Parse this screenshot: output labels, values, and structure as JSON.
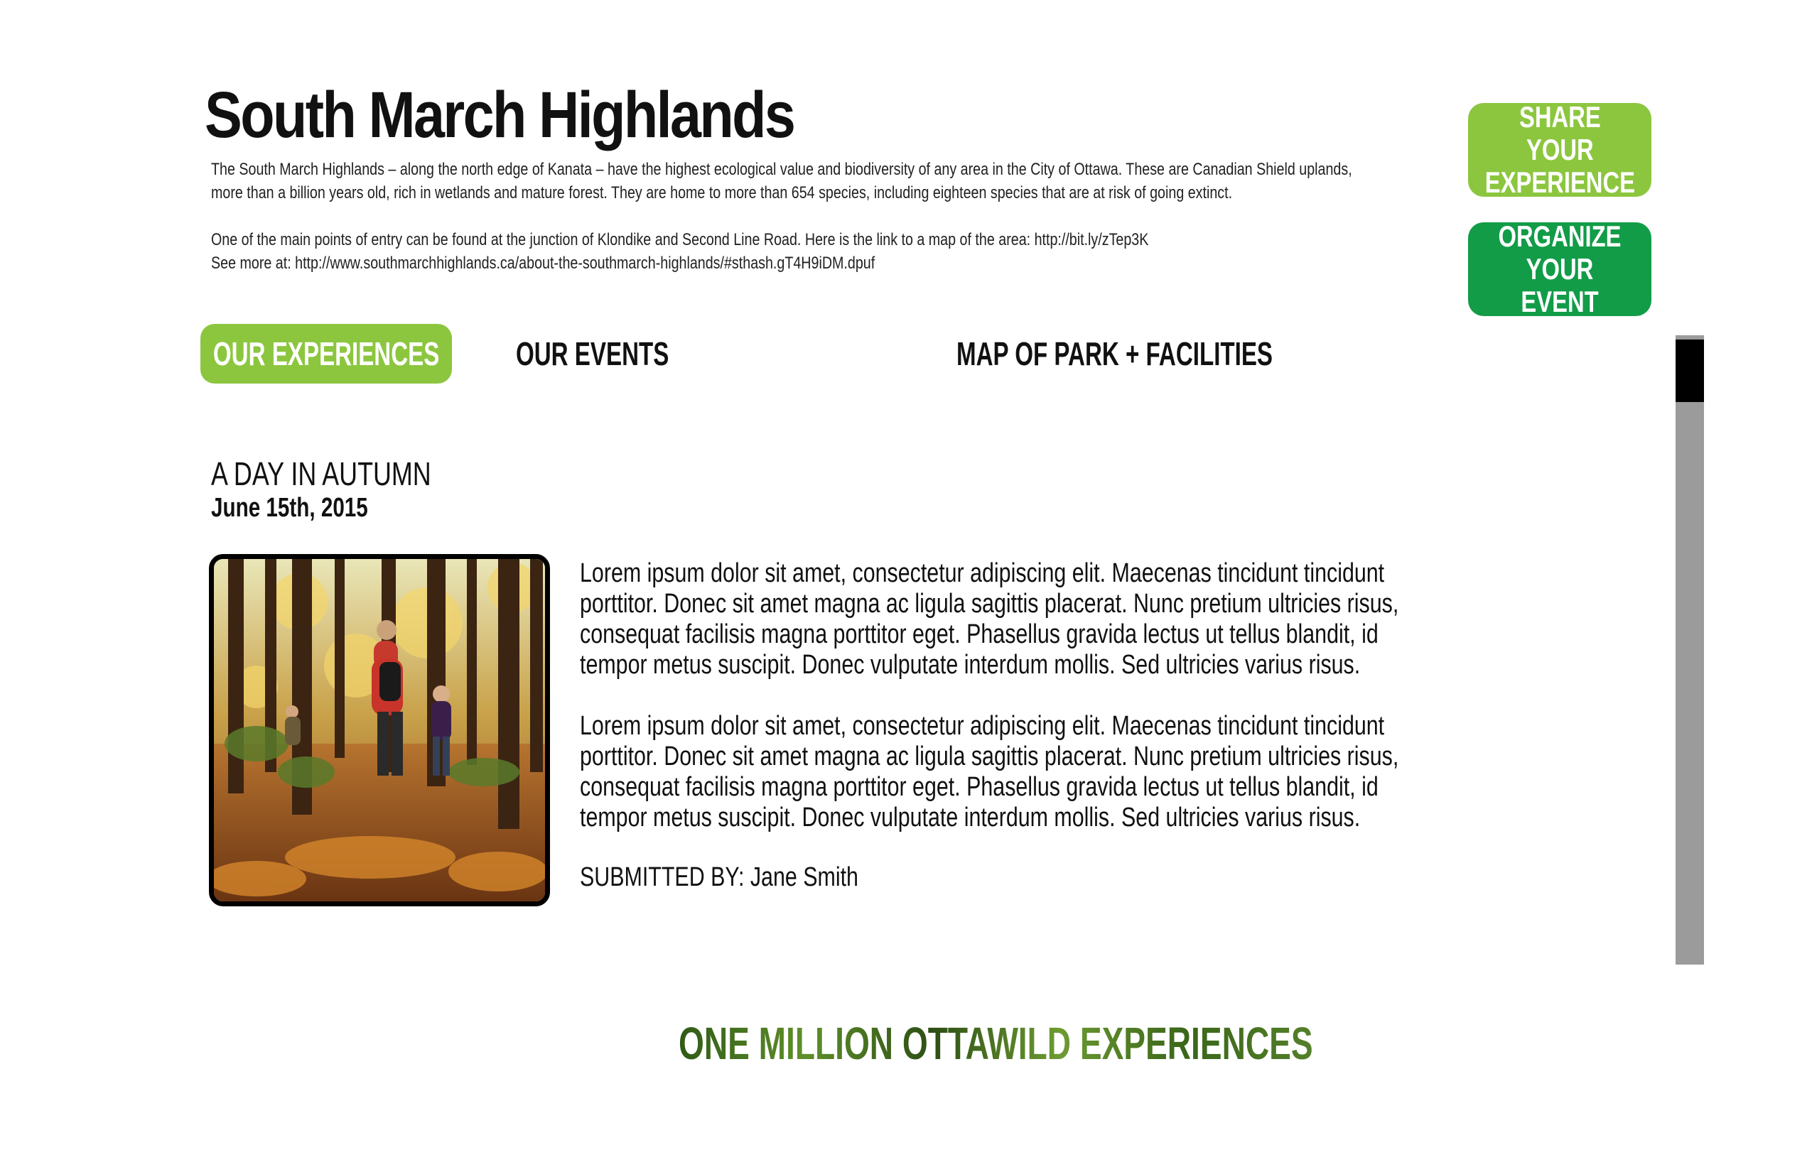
{
  "header": {
    "title": "South March Highlands",
    "intro_line1": "The South March Highlands – along the north edge of Kanata – have the highest ecological value and biodiversity of any area in the City of Ottawa. These are Canadian Shield uplands,",
    "intro_line2": "more than a billion years old, rich in wetlands and mature forest. They are home to more than 654 species, including eighteen species that are at risk of going extinct.",
    "intro_line3": "One of the main points of entry can be found at the junction of Klondike and Second Line Road. Here is the link to a map of the area: http://bit.ly/zTep3K",
    "intro_line4": "See more at: http://www.southmarchhighlands.ca/about-the-southmarch-highlands/#sthash.gT4H9iDM.dpuf"
  },
  "sidebar": {
    "share_label": "SHARE YOUR EXPERIENCE",
    "organize_label": "ORGANIZE YOUR EVENT"
  },
  "tabs": [
    {
      "label": "OUR EXPERIENCES",
      "active": true
    },
    {
      "label": "OUR EVENTS",
      "active": false
    },
    {
      "label": "MAP OF PARK + FACILITIES",
      "active": false
    }
  ],
  "experience": {
    "title": "A DAY IN AUTUMN",
    "date": "June 15th, 2015",
    "paragraph1": "Lorem ipsum dolor sit amet, consectetur adipiscing elit. Maecenas tincidunt tincidunt porttitor. Donec sit amet magna ac ligula sagittis placerat. Nunc pretium ultricies risus, consequat facilisis magna porttitor eget. Phasellus gravida lectus ut tellus blandit, id tempor metus suscipit. Donec vulputate interdum mollis. Sed ultricies varius risus.",
    "paragraph2": "Lorem ipsum dolor sit amet, consectetur adipiscing elit. Maecenas tincidunt tincidunt porttitor. Donec sit amet magna ac ligula sagittis placerat. Nunc pretium ultricies risus, consequat facilisis magna porttitor eget. Phasellus gravida lectus ut tellus blandit, id tempor metus suscipit. Donec vulputate interdum mollis. Sed ultricies varius risus.",
    "submitted_by": "SUBMITTED BY: Jane Smith"
  },
  "footer": {
    "tagline": "ONE MILLION OTTAWILD EXPERIENCES"
  },
  "colors": {
    "light_green": "#8cc63f",
    "dark_green": "#129c48",
    "scrollbar_track": "#9b9b9b",
    "scrollbar_thumb": "#000000"
  }
}
